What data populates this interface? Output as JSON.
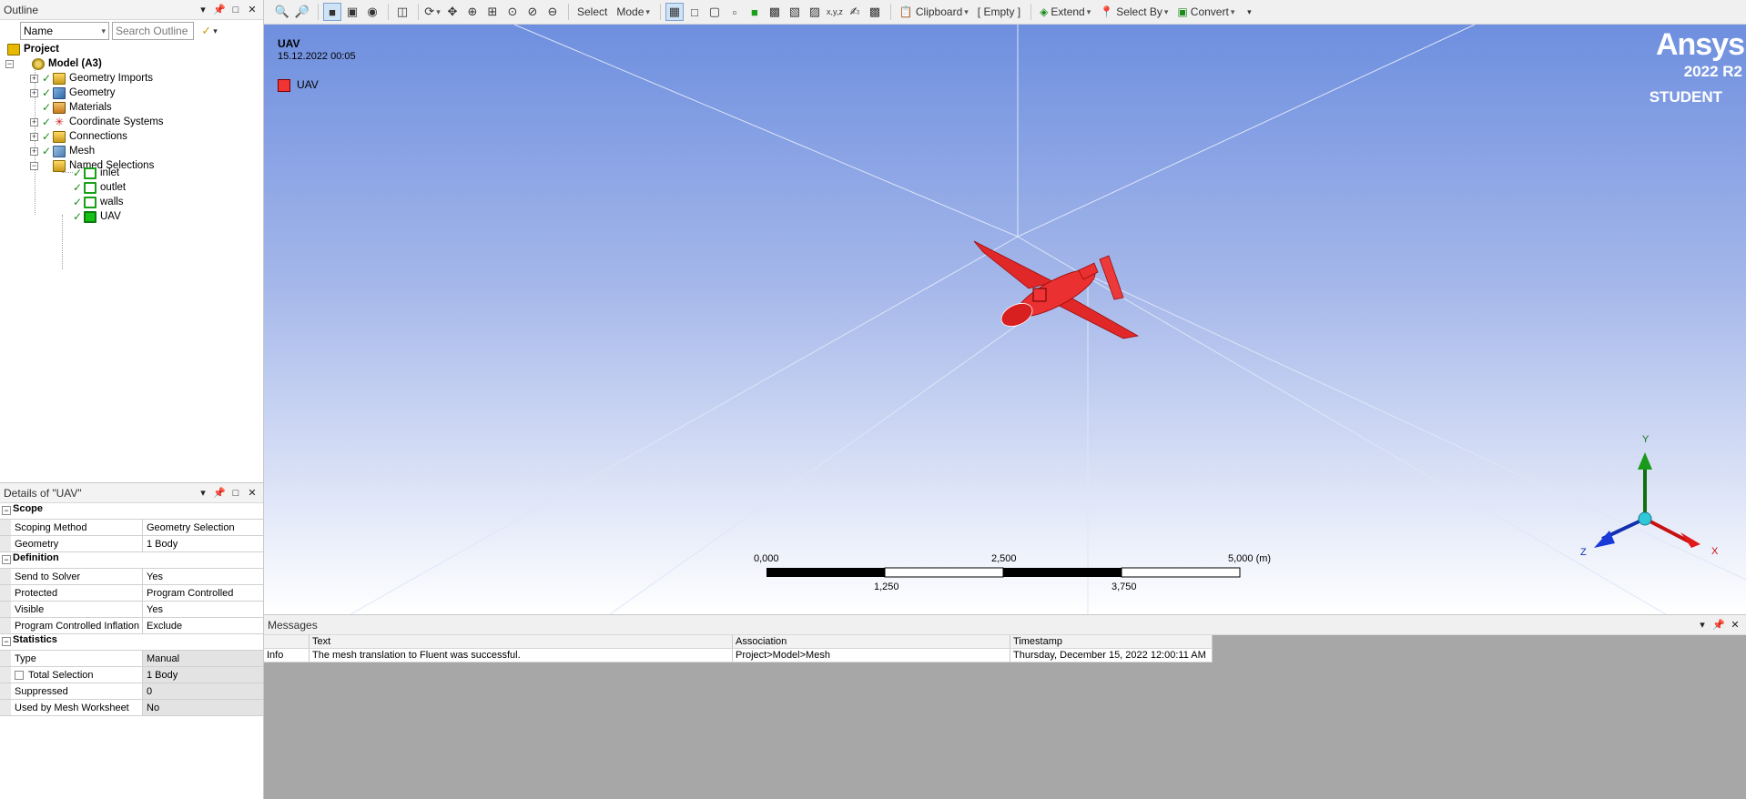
{
  "outline": {
    "title": "Outline",
    "filter_combo": "Name",
    "search_placeholder": "Search Outline",
    "tree": {
      "project": "Project",
      "model": "Model (A3)",
      "items": [
        "Geometry Imports",
        "Geometry",
        "Materials",
        "Coordinate Systems",
        "Connections",
        "Mesh",
        "Named Selections"
      ],
      "named_selections": [
        "inlet",
        "outlet",
        "walls",
        "UAV"
      ]
    }
  },
  "details": {
    "title": "Details of \"UAV\"",
    "sections": {
      "scope": "Scope",
      "definition": "Definition",
      "statistics": "Statistics"
    },
    "rows": {
      "scoping_method": {
        "k": "Scoping Method",
        "v": "Geometry Selection"
      },
      "geometry": {
        "k": "Geometry",
        "v": "1 Body"
      },
      "send_to_solver": {
        "k": "Send to Solver",
        "v": "Yes"
      },
      "protected": {
        "k": "Protected",
        "v": "Program Controlled"
      },
      "visible": {
        "k": "Visible",
        "v": "Yes"
      },
      "pci": {
        "k": "Program Controlled Inflation",
        "v": "Exclude"
      },
      "type": {
        "k": "Type",
        "v": "Manual"
      },
      "total_selection": {
        "k": "Total Selection",
        "v": "1 Body"
      },
      "suppressed": {
        "k": "Suppressed",
        "v": "0"
      },
      "used_by_mesh": {
        "k": "Used by Mesh Worksheet",
        "v": "No"
      }
    }
  },
  "toolbar": {
    "select": "Select",
    "mode": "Mode",
    "clipboard": "Clipboard",
    "empty": "[ Empty ]",
    "extend": "Extend",
    "select_by": "Select By",
    "convert": "Convert"
  },
  "viewport": {
    "title": "UAV",
    "date": "15.12.2022 00:05",
    "legend_label": "UAV",
    "legend_color": "#f03333",
    "brand_logo": "Ansys",
    "brand_version": "2022 R2",
    "brand_edition": "STUDENT",
    "scale_top": [
      "0,000",
      "2,500",
      "5,000 (m)"
    ],
    "scale_bottom": [
      "1,250",
      "3,750"
    ],
    "axis_labels": {
      "x": "X",
      "y": "Y",
      "z": "Z"
    }
  },
  "messages": {
    "title": "Messages",
    "columns": [
      "",
      "Text",
      "Association",
      "Timestamp"
    ],
    "rows": [
      [
        "Info",
        "The mesh translation to Fluent was successful.",
        "Project>Model>Mesh",
        "Thursday, December 15, 2022 12:00:11 AM"
      ]
    ]
  }
}
